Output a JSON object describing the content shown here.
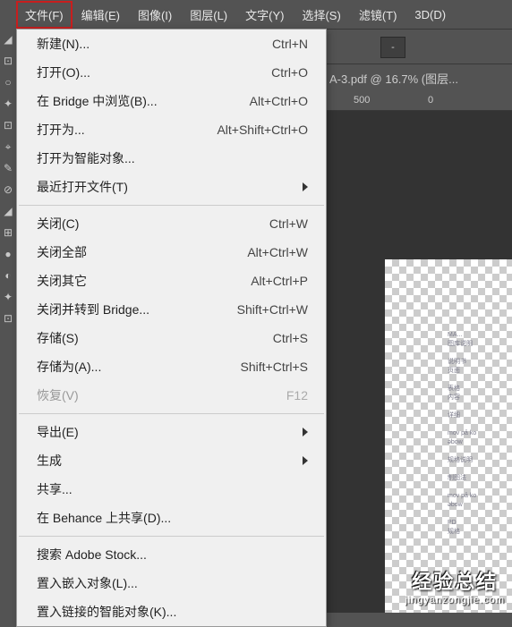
{
  "menubar": {
    "items": [
      {
        "label": "文件(F)",
        "active": true
      },
      {
        "label": "编辑(E)"
      },
      {
        "label": "图像(I)"
      },
      {
        "label": "图层(L)"
      },
      {
        "label": "文字(Y)"
      },
      {
        "label": "选择(S)"
      },
      {
        "label": "滤镜(T)"
      },
      {
        "label": "3D(D)"
      }
    ]
  },
  "toolbar": {
    "dropdown_value": "-"
  },
  "tab": {
    "filename": "A-3.pdf @ 16.7% (图层..."
  },
  "ruler": {
    "marks": [
      {
        "label": "500",
        "pos": 395
      },
      {
        "label": "0",
        "pos": 478
      }
    ]
  },
  "menu": {
    "groups": [
      [
        {
          "label": "新建(N)...",
          "shortcut": "Ctrl+N"
        },
        {
          "label": "打开(O)...",
          "shortcut": "Ctrl+O"
        },
        {
          "label": "在 Bridge 中浏览(B)...",
          "shortcut": "Alt+Ctrl+O"
        },
        {
          "label": "打开为...",
          "shortcut": "Alt+Shift+Ctrl+O"
        },
        {
          "label": "打开为智能对象..."
        },
        {
          "label": "最近打开文件(T)",
          "submenu": true
        }
      ],
      [
        {
          "label": "关闭(C)",
          "shortcut": "Ctrl+W"
        },
        {
          "label": "关闭全部",
          "shortcut": "Alt+Ctrl+W"
        },
        {
          "label": "关闭其它",
          "shortcut": "Alt+Ctrl+P"
        },
        {
          "label": "关闭并转到 Bridge...",
          "shortcut": "Shift+Ctrl+W"
        },
        {
          "label": "存储(S)",
          "shortcut": "Ctrl+S"
        },
        {
          "label": "存储为(A)...",
          "shortcut": "Shift+Ctrl+S"
        },
        {
          "label": "恢复(V)",
          "shortcut": "F12",
          "disabled": true
        }
      ],
      [
        {
          "label": "导出(E)",
          "submenu": true
        },
        {
          "label": "生成",
          "submenu": true
        },
        {
          "label": "共享..."
        },
        {
          "label": "在 Behance 上共享(D)..."
        }
      ],
      [
        {
          "label": "搜索 Adobe Stock..."
        },
        {
          "label": "置入嵌入对象(L)..."
        },
        {
          "label": "置入链接的智能对象(K)..."
        }
      ]
    ]
  },
  "watermark": {
    "main": "经验总结",
    "sub": "jingyanzongjie.com"
  }
}
